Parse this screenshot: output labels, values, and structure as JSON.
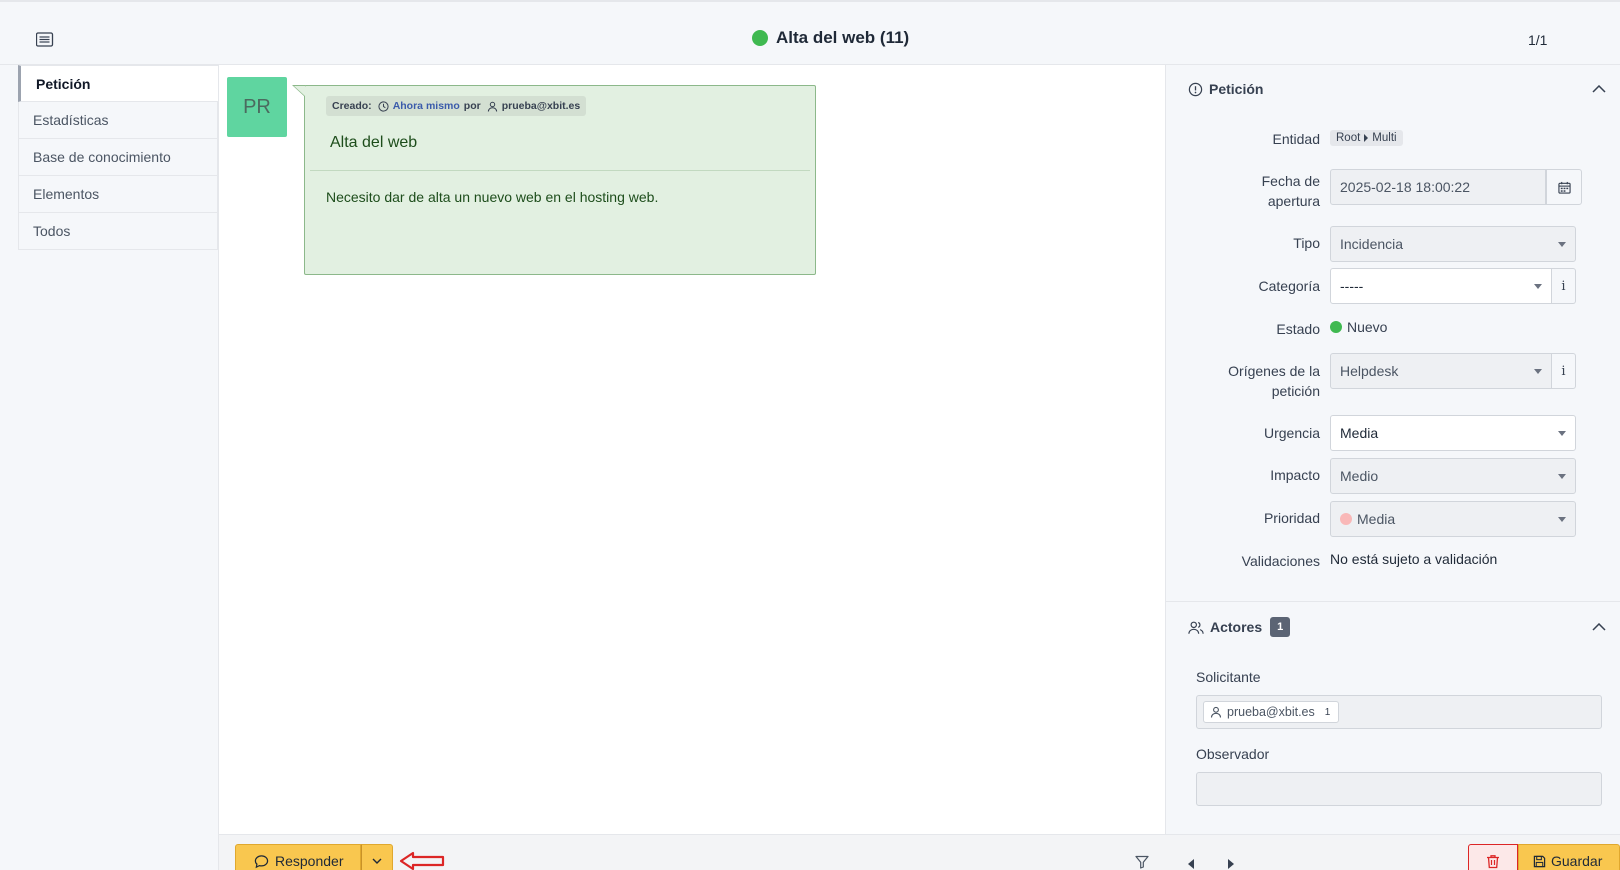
{
  "header": {
    "title": "Alta del web (11)",
    "status_color": "#3fb950",
    "pager": "1/1"
  },
  "tabs": [
    {
      "label": "Petición",
      "active": true
    },
    {
      "label": "Estadísticas"
    },
    {
      "label": "Base de conocimiento"
    },
    {
      "label": "Elementos"
    },
    {
      "label": "Todos"
    }
  ],
  "timeline": {
    "avatar_initials": "PR",
    "created_label": "Creado:",
    "created_when": "Ahora mismo",
    "created_by_label": "por",
    "created_user": "prueba@xbit.es",
    "item_title": "Alta del web",
    "item_body": "Necesito dar de alta un nuevo web en el hosting web."
  },
  "actions": {
    "reply_label": "Responder",
    "save_label": "Guardar"
  },
  "ticket": {
    "section_title": "Petición",
    "fields": {
      "entity_label": "Entidad",
      "entity_root": "Root",
      "entity_child": "Multi",
      "open_date_label_1": "Fecha de",
      "open_date_label_2": "apertura",
      "open_date_value": "2025-02-18 18:00:22",
      "type_label": "Tipo",
      "type_value": "Incidencia",
      "category_label": "Categoría",
      "category_value": "-----",
      "status_label": "Estado",
      "status_value": "Nuevo",
      "status_color": "#3fb950",
      "origin_label_1": "Orígenes de la",
      "origin_label_2": "petición",
      "origin_value": "Helpdesk",
      "urgency_label": "Urgencia",
      "urgency_value": "Media",
      "impact_label": "Impacto",
      "impact_value": "Medio",
      "priority_label": "Prioridad",
      "priority_value": "Media",
      "priority_color": "#f9b8b8",
      "validation_label": "Validaciones",
      "validation_value": "No está sujeto a validación"
    }
  },
  "actors": {
    "section_title": "Actores",
    "count": "1",
    "requester_label": "Solicitante",
    "requester_user": "prueba@xbit.es",
    "requester_count": "1",
    "observer_label": "Observador"
  }
}
